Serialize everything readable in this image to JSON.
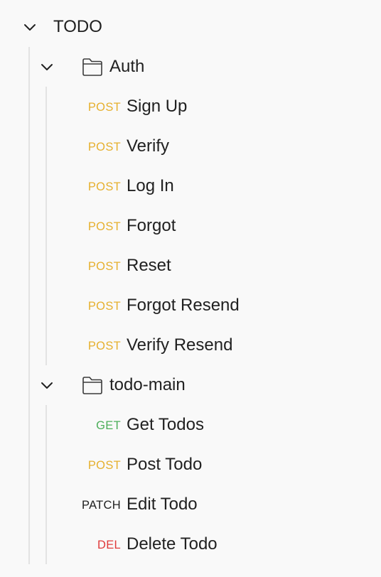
{
  "collection": {
    "name": "TODO",
    "expanded": true
  },
  "method_colors": {
    "POST": "#e6b02e",
    "GET": "#4cae5a",
    "PATCH": "#212121",
    "DEL": "#e03b3b"
  },
  "folders": [
    {
      "name": "Auth",
      "icon": "folder-icon",
      "expanded": true,
      "requests": [
        {
          "method": "POST",
          "name": "Sign Up"
        },
        {
          "method": "POST",
          "name": "Verify"
        },
        {
          "method": "POST",
          "name": "Log In"
        },
        {
          "method": "POST",
          "name": "Forgot"
        },
        {
          "method": "POST",
          "name": "Reset"
        },
        {
          "method": "POST",
          "name": "Forgot Resend"
        },
        {
          "method": "POST",
          "name": "Verify Resend"
        }
      ]
    },
    {
      "name": "todo-main",
      "icon": "folder-icon",
      "expanded": true,
      "requests": [
        {
          "method": "GET",
          "name": "Get Todos"
        },
        {
          "method": "POST",
          "name": "Post Todo"
        },
        {
          "method": "PATCH",
          "name": "Edit Todo"
        },
        {
          "method": "DEL",
          "name": "Delete Todo"
        }
      ]
    }
  ]
}
